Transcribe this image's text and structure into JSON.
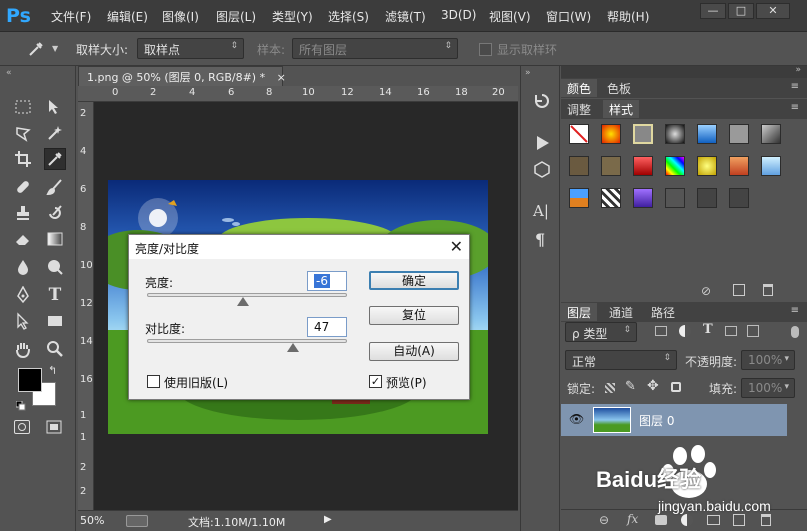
{
  "app": {
    "logo": "Ps"
  },
  "menu": [
    "文件(F)",
    "编辑(E)",
    "图像(I)",
    "图层(L)",
    "类型(Y)",
    "选择(S)",
    "滤镜(T)",
    "3D(D)",
    "视图(V)",
    "窗口(W)",
    "帮助(H)"
  ],
  "window_buttons": {
    "minimize": "—",
    "maximize": "□",
    "close": "✕"
  },
  "options": {
    "sample_size_label": "取样大小:",
    "sample_size_value": "取样点",
    "sample_label": "样本:",
    "sample_value": "所有图层",
    "show_ring_label": "显示取样环"
  },
  "document": {
    "tab_title": "1.png @ 50% (图层 0, RGB/8#) *",
    "tab_close": "×",
    "zoom": "50%",
    "doc_info": "文档:1.10M/1.10M"
  },
  "ruler": {
    "top": [
      "0",
      "2",
      "4",
      "6",
      "8",
      "10",
      "12",
      "14",
      "16",
      "18",
      "20"
    ],
    "left": [
      "2",
      "4",
      "6",
      "8",
      "10",
      "12",
      "14",
      "16",
      "1",
      "1",
      "2",
      "2"
    ]
  },
  "dialog": {
    "title": "亮度/对比度",
    "close": "✕",
    "brightness_label": "亮度:",
    "brightness_value": "-6",
    "brightness_level": 0.48,
    "contrast_label": "对比度:",
    "contrast_value": "47",
    "contrast_level": 0.73,
    "use_legacy_label": "使用旧版(L)",
    "use_legacy_checked": false,
    "preview_label": "预览(P)",
    "preview_checked": true,
    "ok_label": "确定",
    "reset_label": "复位",
    "auto_label": "自动(A)"
  },
  "panels": {
    "color_tabs": [
      "颜色",
      "色板"
    ],
    "style_tabs": [
      "调整",
      "样式"
    ],
    "layer_tabs": [
      "图层",
      "通道",
      "路径"
    ],
    "filter_kind": "ρ 类型",
    "blend_mode": "正常",
    "opacity_label": "不透明度:",
    "opacity_value": "100%",
    "lock_label": "锁定:",
    "fill_label": "填充:",
    "fill_value": "100%",
    "layer_name": "图层 0"
  },
  "watermark": {
    "brand": "Baidu经验",
    "url": "jingyan.baidu.com"
  },
  "colors": {
    "ps_blue": "#31a8ff",
    "foreground": "#000000",
    "background": "#ffffff",
    "layer_selected": "#7f95b0"
  }
}
